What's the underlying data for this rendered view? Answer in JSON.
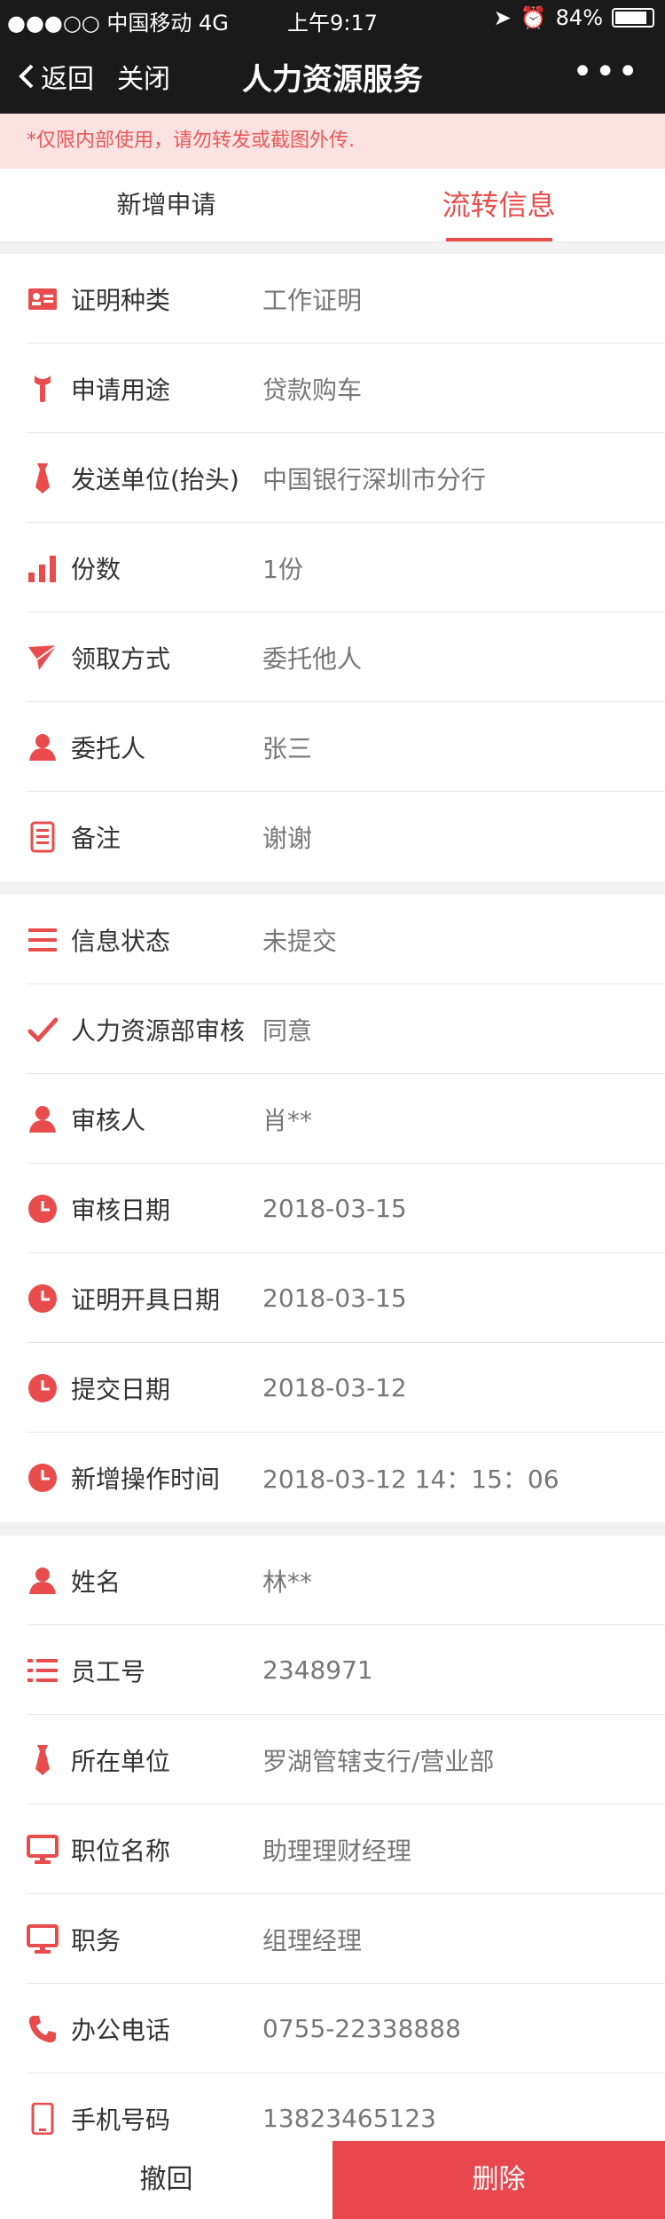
{
  "status_bar": {
    "carrier": "●●●○○ 中国移动",
    "network": "4G",
    "time": "上午9:17",
    "battery": "84%"
  },
  "nav": {
    "back_label": "返回",
    "close_label": "关闭",
    "title": "人力资源服务",
    "more_label": "•••"
  },
  "notice": "*仅限内部使用，请勿转发或截图外传.",
  "tabs": [
    {
      "label": "新增申请"
    },
    {
      "label": "流转信息"
    }
  ],
  "section1": [
    {
      "label": "证明种类",
      "value": "工作证明",
      "icon": "id-card-icon"
    },
    {
      "label": "申请用途",
      "value": "贷款购车",
      "icon": "wrench-icon"
    },
    {
      "label": "发送单位(抬头)",
      "value": "中国银行深圳市分行",
      "icon": "tie-icon"
    },
    {
      "label": "份数",
      "value": "1份",
      "icon": "bar-chart-icon"
    },
    {
      "label": "领取方式",
      "value": "委托他人",
      "icon": "paper-plane-icon"
    },
    {
      "label": "委托人",
      "value": "张三",
      "icon": "person-icon"
    },
    {
      "label": "备注",
      "value": "谢谢",
      "icon": "document-icon"
    }
  ],
  "section2": [
    {
      "label": "信息状态",
      "value": "未提交",
      "icon": "list-icon"
    },
    {
      "label": "人力资源部审核",
      "value": "同意",
      "icon": "check-icon"
    },
    {
      "label": "审核人",
      "value": "肖**",
      "icon": "person-icon"
    },
    {
      "label": "审核日期",
      "value": "2018-03-15",
      "icon": "clock-icon"
    },
    {
      "label": "证明开具日期",
      "value": "2018-03-15",
      "icon": "clock-icon"
    },
    {
      "label": "提交日期",
      "value": "2018-03-12",
      "icon": "clock-icon"
    },
    {
      "label": "新增操作时间",
      "value": "2018-03-12  14：15：06",
      "icon": "clock-icon"
    }
  ],
  "section3": [
    {
      "label": "姓名",
      "value": "林**",
      "icon": "person-icon"
    },
    {
      "label": "员工号",
      "value": "2348971",
      "icon": "employee-list-icon"
    },
    {
      "label": "所在单位",
      "value": "罗湖管辖支行/营业部",
      "icon": "tie-icon"
    },
    {
      "label": "职位名称",
      "value": "助理理财经理",
      "icon": "monitor-icon"
    },
    {
      "label": "职务",
      "value": "组理经理",
      "icon": "monitor-icon"
    },
    {
      "label": "办公电话",
      "value": "0755-22338888",
      "icon": "phone-icon"
    },
    {
      "label": "手机号码",
      "value": "13823465123",
      "icon": "mobile-icon"
    }
  ],
  "bottom": {
    "cancel_label": "撤回",
    "delete_label": "删除"
  },
  "accent_color": "#e84c4c"
}
